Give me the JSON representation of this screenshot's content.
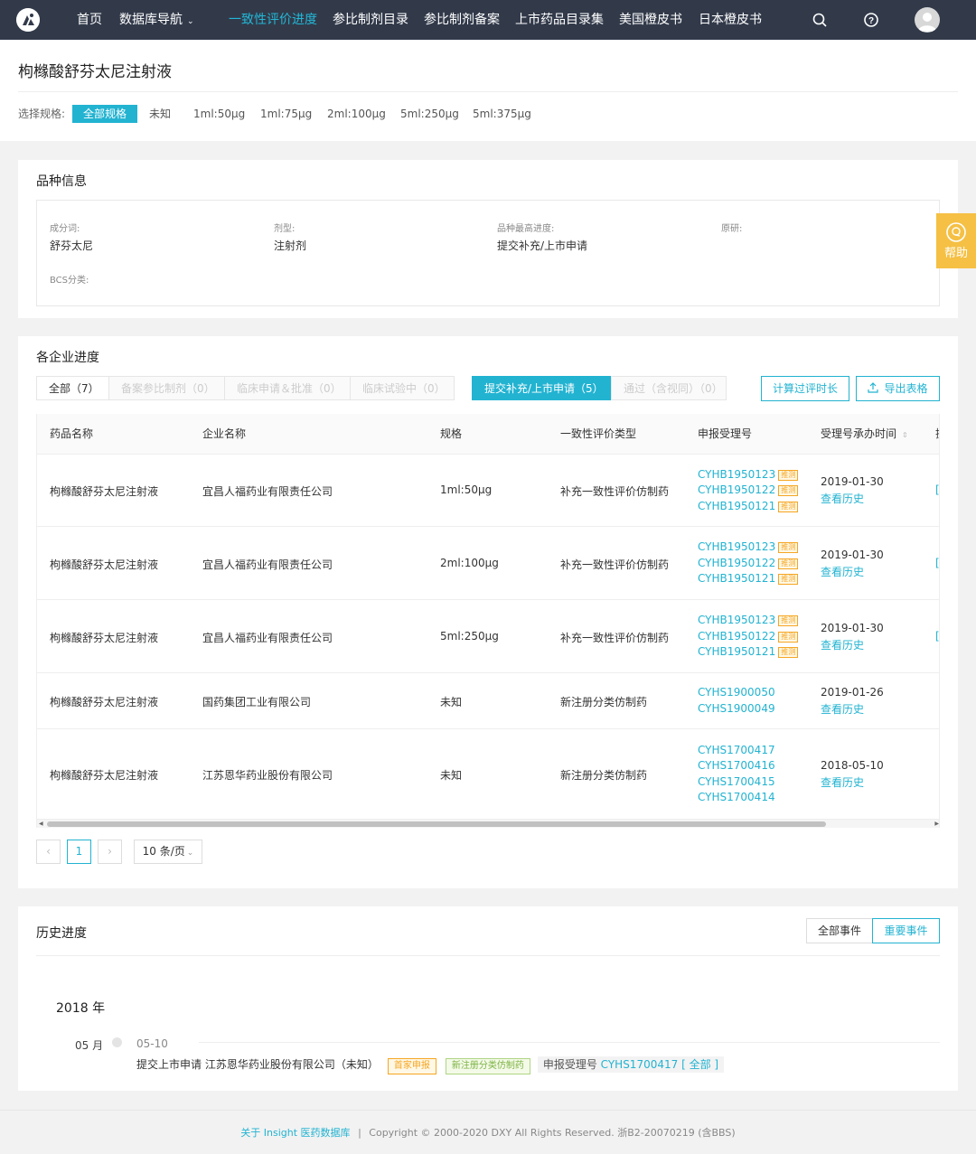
{
  "nav": {
    "items": [
      "首页",
      "数据库导航",
      "一致性评价进度",
      "参比制剂目录",
      "参比制剂备案",
      "上市药品目录集",
      "美国橙皮书",
      "日本橙皮书"
    ],
    "active_index": 2,
    "icons": [
      "search-icon",
      "help-circle-icon",
      "user-avatar-icon"
    ]
  },
  "page": {
    "title": "枸橼酸舒芬太尼注射液",
    "spec_label": "选择规格:",
    "specs": [
      "全部规格",
      "未知",
      "1ml:50μg",
      "1ml:75μg",
      "2ml:100μg",
      "5ml:250μg",
      "5ml:375μg"
    ],
    "selected_spec": 0
  },
  "variety": {
    "title": "品种信息",
    "fields": [
      {
        "label": "成分词:",
        "value": "舒芬太尼"
      },
      {
        "label": "剂型:",
        "value": "注射剂"
      },
      {
        "label": "品种最高进度:",
        "value": "提交补充/上市申请"
      },
      {
        "label": "原研:",
        "value": ""
      },
      {
        "label": "BCS分类:",
        "value": ""
      }
    ]
  },
  "progress": {
    "title": "各企业进度",
    "tabs": [
      "全部（7）",
      "备案参比制剂（0）",
      "临床申请＆批准（0）",
      "临床试验中（0）",
      "提交补充/上市申请（5）",
      "通过（含视同）（0）"
    ],
    "active_tab": 4,
    "btn_calc": "计算过评时长",
    "btn_export": "导出表格",
    "columns": [
      "药品名称",
      "企业名称",
      "规格",
      "一致性评价类型",
      "申报受理号",
      "受理号承办时间",
      "操"
    ],
    "rows": [
      {
        "drug": "枸橼酸舒芬太尼注射液",
        "company": "宜昌人福药业有限责任公司",
        "spec": "1ml:50μg",
        "type": "补充一致性评价仿制药",
        "codes": [
          "CYHB1950123",
          "CYHB1950122",
          "CYHB1950121"
        ],
        "tag": "推测",
        "date": "2019-01-30",
        "history": "查看历史"
      },
      {
        "drug": "枸橼酸舒芬太尼注射液",
        "company": "宜昌人福药业有限责任公司",
        "spec": "2ml:100μg",
        "type": "补充一致性评价仿制药",
        "codes": [
          "CYHB1950123",
          "CYHB1950122",
          "CYHB1950121"
        ],
        "tag": "推测",
        "date": "2019-01-30",
        "history": "查看历史"
      },
      {
        "drug": "枸橼酸舒芬太尼注射液",
        "company": "宜昌人福药业有限责任公司",
        "spec": "5ml:250μg",
        "type": "补充一致性评价仿制药",
        "codes": [
          "CYHB1950123",
          "CYHB1950122",
          "CYHB1950121"
        ],
        "tag": "推测",
        "date": "2019-01-30",
        "history": "查看历史"
      },
      {
        "drug": "枸橼酸舒芬太尼注射液",
        "company": "国药集团工业有限公司",
        "spec": "未知",
        "type": "新注册分类仿制药",
        "codes": [
          "CYHS1900050",
          "CYHS1900049"
        ],
        "tag": "",
        "date": "2019-01-26",
        "history": "查看历史"
      },
      {
        "drug": "枸橼酸舒芬太尼注射液",
        "company": "江苏恩华药业股份有限公司",
        "spec": "未知",
        "type": "新注册分类仿制药",
        "codes": [
          "CYHS1700417",
          "CYHS1700416",
          "CYHS1700415",
          "CYHS1700414"
        ],
        "tag": "",
        "date": "2018-05-10",
        "history": "查看历史"
      }
    ],
    "pagination": {
      "current": "1",
      "page_size": "10 条/页"
    }
  },
  "history": {
    "title": "历史进度",
    "btn_all": "全部事件",
    "btn_important": "重要事件",
    "year": "2018 年",
    "month": "05 月",
    "date": "05-10",
    "entry_text": "提交上市申请 江苏恩华药业股份有限公司（未知）",
    "pill_first": "首家申报",
    "pill_type": "新注册分类仿制药",
    "code_label": "申报受理号",
    "code": "CYHS1700417",
    "code_all": "[ 全部 ]"
  },
  "help": {
    "label": "帮助"
  },
  "footer": {
    "link": "关于 Insight 医药数据库",
    "sep": "|",
    "copyright": "Copyright © 2000-2020 DXY All Rights Reserved. 浙B2-20070219 (含BBS)"
  },
  "colors": {
    "nav_bg": "#323a4a",
    "accent": "#22b3d1",
    "tag_orange": "#f5a623",
    "help_bg": "#f5c044"
  }
}
